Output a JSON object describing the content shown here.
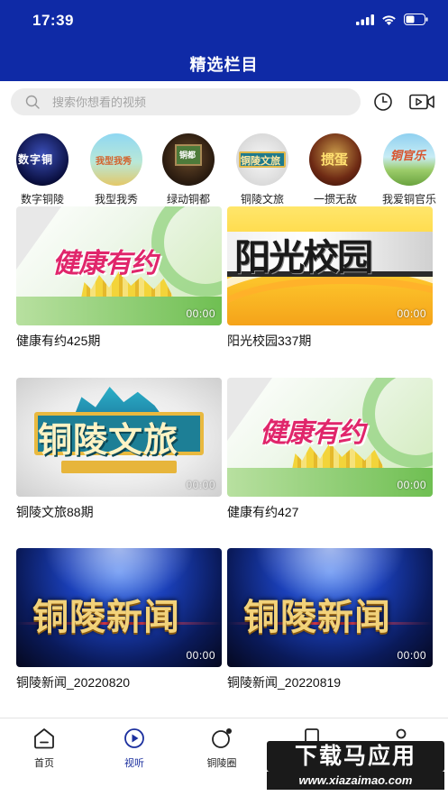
{
  "status_bar": {
    "time": "17:39"
  },
  "header": {
    "title": "精选栏目"
  },
  "search": {
    "placeholder": "搜索你想看的视频"
  },
  "categories": [
    {
      "label": "数字铜陵",
      "badge": "数字铜"
    },
    {
      "label": "我型我秀",
      "badge": "我型我秀"
    },
    {
      "label": "绿动铜都",
      "badge": "铜都"
    },
    {
      "label": "铜陵文旅",
      "badge": "铜陵文旅"
    },
    {
      "label": "一掼无敌",
      "badge": "掼蛋"
    },
    {
      "label": "我爱铜官乐",
      "badge": "铜官乐"
    }
  ],
  "videos": [
    {
      "title": "健康有约425期",
      "duration": "00:00",
      "logo": "健康有约",
      "style": "health"
    },
    {
      "title": "阳光校园337期",
      "duration": "00:00",
      "logo": "阳光校园",
      "style": "campus"
    },
    {
      "title": "铜陵文旅88期",
      "duration": "00:00",
      "logo": "铜陵文旅",
      "style": "tourism"
    },
    {
      "title": "健康有约427",
      "duration": "00:00",
      "logo": "健康有约",
      "style": "health"
    },
    {
      "title": "铜陵新闻_20220820",
      "duration": "00:00",
      "logo": "铜陵新闻",
      "style": "news"
    },
    {
      "title": "铜陵新闻_20220819",
      "duration": "00:00",
      "logo": "铜陵新闻",
      "style": "news"
    }
  ],
  "tabbar": [
    {
      "label": "首页",
      "icon": "home-icon",
      "active": false
    },
    {
      "label": "视听",
      "icon": "play-icon",
      "active": true
    },
    {
      "label": "铜陵圈",
      "icon": "circle-icon",
      "active": false
    },
    {
      "label": "",
      "icon": "document-icon",
      "active": false
    },
    {
      "label": "",
      "icon": "user-icon",
      "active": false
    }
  ],
  "watermark": {
    "top": "下载马应用",
    "bottom": "www.xiazaimao.com"
  },
  "colors": {
    "brand": "#0f2aa6",
    "active_tab": "#1b2f9e"
  }
}
